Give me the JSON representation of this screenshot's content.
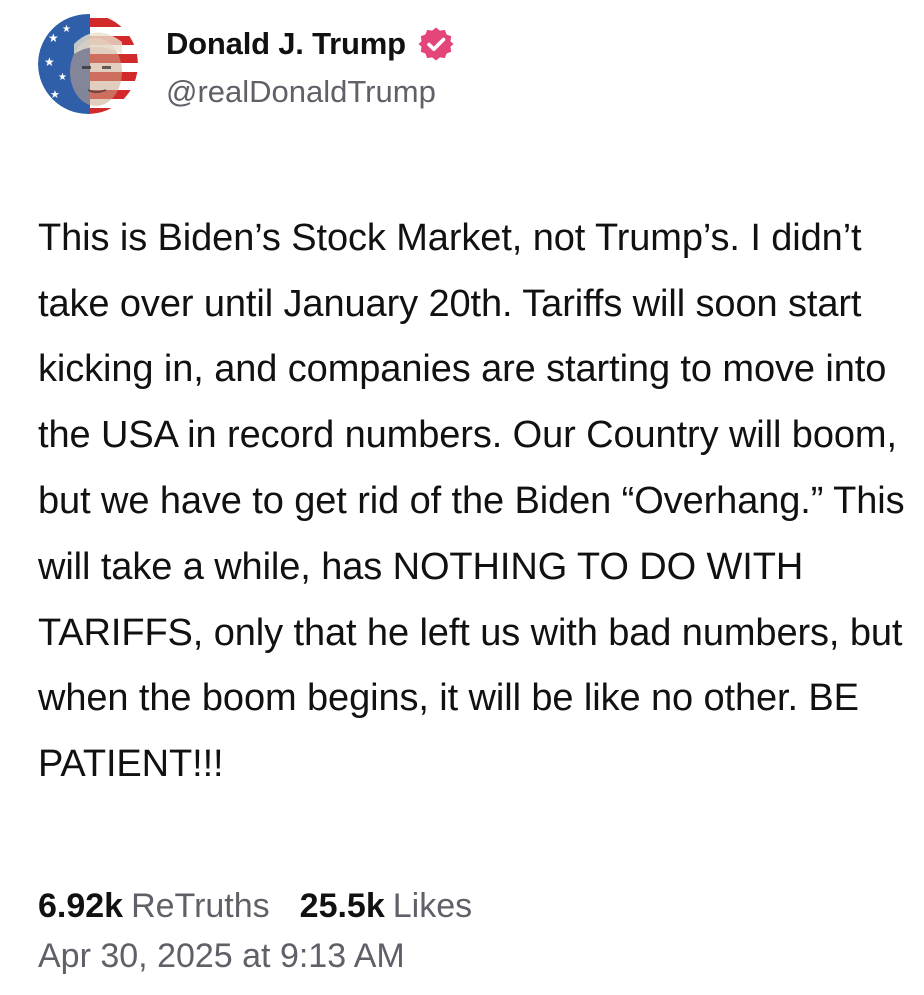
{
  "author": {
    "display_name": "Donald J. Trump",
    "handle": "@realDonaldTrump",
    "verified_icon": "verified-badge-icon",
    "badge_color": "#e5467a"
  },
  "post": {
    "text": "This is Biden’s Stock Market, not Trump’s. I didn’t take over until January 20th. Tariffs will soon start kicking in, and companies are starting to move into the USA in record numbers. Our Country will boom, but we have to get rid of the Biden “Overhang.” This will take a while, has NOTHING TO DO WITH TARIFFS, only that he left us with bad numbers, but when the boom begins, it will be like no other. BE PATIENT!!!",
    "retruths_count": "6.92k",
    "retruths_label": "ReTruths",
    "likes_count": "25.5k",
    "likes_label": "Likes",
    "timestamp": "Apr 30, 2025 at 9:13 AM"
  },
  "colors": {
    "text": "#111111",
    "muted": "#5f6068"
  }
}
